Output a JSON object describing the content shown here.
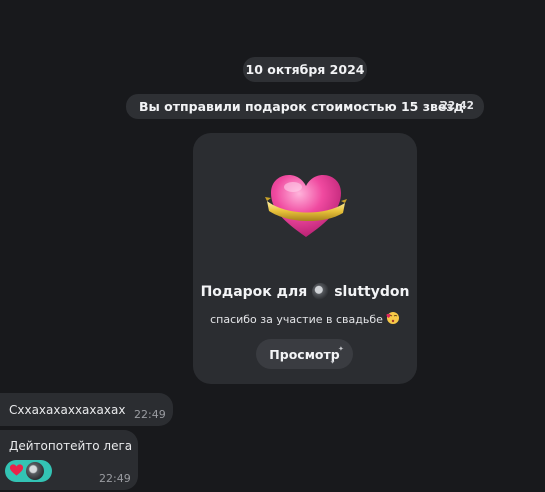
{
  "chat": {
    "date": "10 октября 2024",
    "service_message": {
      "text": "Вы отправили подарок стоимостью 15 звёзд",
      "time": "22:42"
    },
    "gift": {
      "title_prefix": "Подарок для",
      "recipient": "sluttydon",
      "message": "спасибо за участие в свадьбе",
      "view_label": "Просмотр",
      "icon": "pink-heart-with-gold-ribbon",
      "colors": {
        "heart": "#f04aa0",
        "ribbon": "#e8c23a"
      }
    },
    "messages": [
      {
        "text": "Сххахахаххахахах",
        "time": "22:49"
      },
      {
        "text": "Дейтопотейто лега",
        "time": "22:49",
        "reaction": "heart"
      }
    ]
  },
  "theme": {
    "background": "#18191c",
    "bubble": "#2b2d31",
    "reaction_accent": "#33c3b4"
  }
}
